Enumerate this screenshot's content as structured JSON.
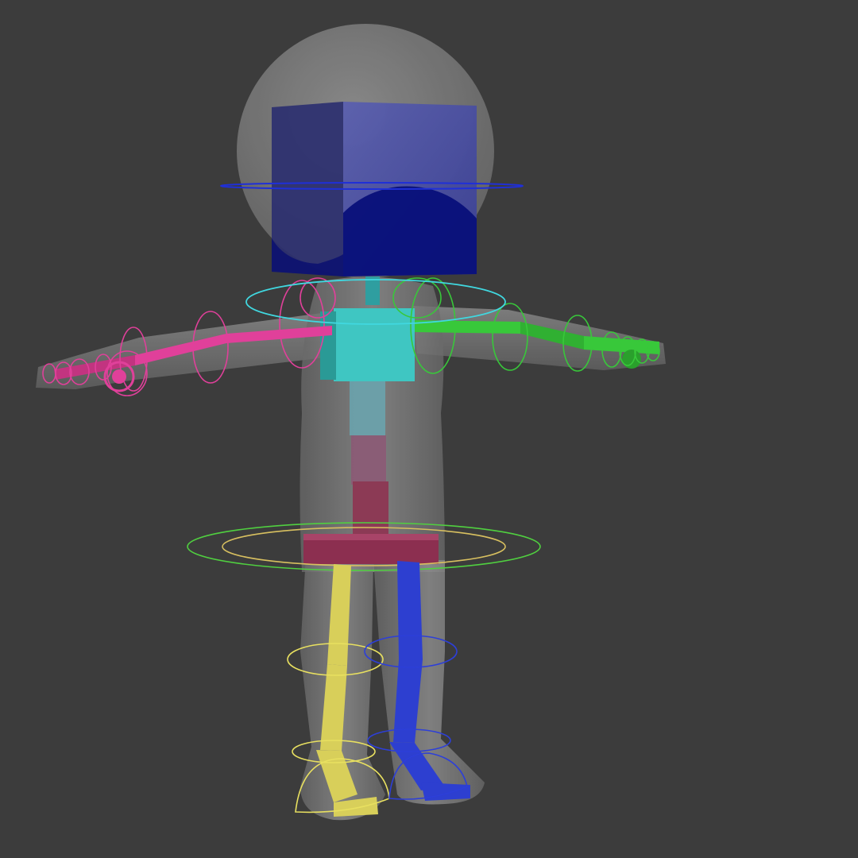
{
  "viewport": {
    "background": "#3c3c3c"
  },
  "rig": {
    "mesh_color": "#8a8a8a",
    "head_box_color": "#3a3f9a",
    "torso_color": "#3fc6c2",
    "spine_color": "#8c3a55",
    "left_arm_color": "#e0409a",
    "right_arm_color": "#38c83a",
    "left_leg_color": "#d8cf5a",
    "right_leg_color": "#2d3fd0",
    "head_ring_color": "#1f2fd8",
    "shoulder_ring_color": "#40d8e0",
    "hip_outer_ring_color": "#50d040",
    "hip_inner_ring_color": "#d8c060"
  }
}
